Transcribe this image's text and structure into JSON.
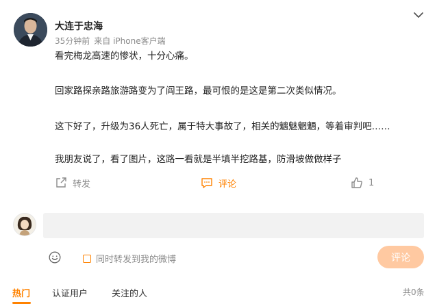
{
  "post": {
    "username": "大连于忠海",
    "time": "35分钟前",
    "source": "来自 iPhone客户端",
    "paragraphs": [
      "看完梅龙高速的惨状，十分心痛。",
      "回家路探亲路旅游路变为了阎王路，最可恨的是这是第二次类似情况。",
      "这下好了，升级为36人死亡，属于特大事故了，相关的魑魅魍魉，等着审判吧……",
      "我朋友说了，看了图片，这路一看就是半填半挖路基，防滑坡做做样子"
    ]
  },
  "actions": {
    "repost_label": "转发",
    "comment_label": "评论",
    "like_count": "1"
  },
  "comment_box": {
    "input_value": "",
    "forward_label": "同时转发到我的微博",
    "submit_label": "评论"
  },
  "tabs": [
    "热门",
    "认证用户",
    "关注的人"
  ],
  "total_label": "共0条",
  "colors": {
    "accent": "#ff8200",
    "submit_bg": "#ffc9a1",
    "input_bg": "#f2f2f2"
  },
  "icons": [
    "chevron-down-icon",
    "repost-icon",
    "comment-icon",
    "like-icon",
    "emoji-icon"
  ]
}
